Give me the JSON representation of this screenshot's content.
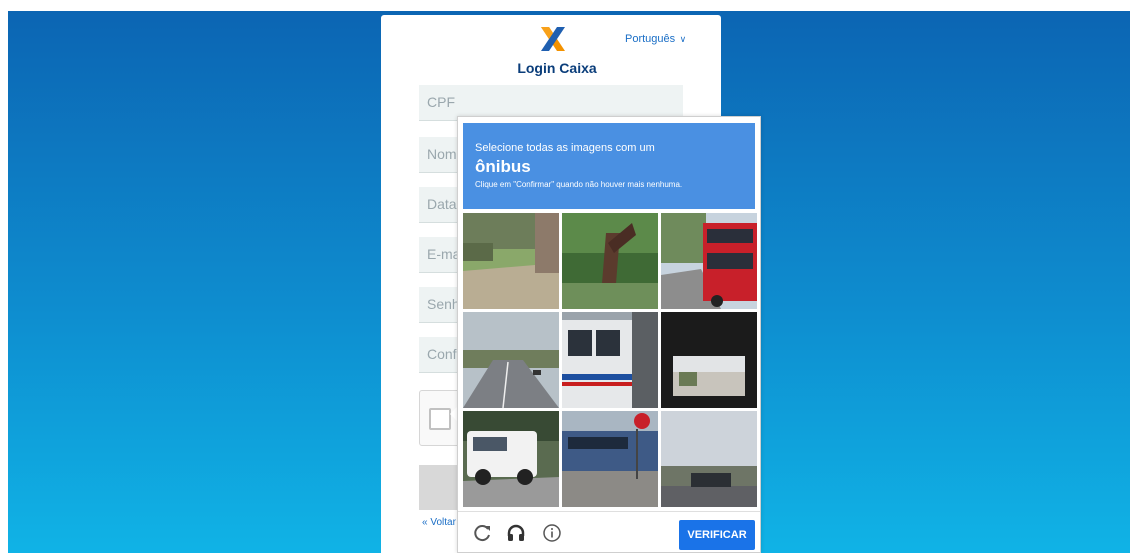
{
  "page": {
    "brand": "Login Caixa",
    "language": "Português",
    "back_link": "« Voltar"
  },
  "form": {
    "fields": [
      {
        "placeholder": "CPF"
      },
      {
        "placeholder": "Nom"
      },
      {
        "placeholder": "Data"
      },
      {
        "placeholder": "E-ma"
      },
      {
        "placeholder": "Senh"
      },
      {
        "placeholder": "Conf"
      }
    ]
  },
  "captcha": {
    "instruction": "Selecione todas as imagens com um",
    "target": "ônibus",
    "hint": "Clique em \"Confirmar\" quando não houver mais nenhuma.",
    "verify_label": "VERIFICAR",
    "tiles": [
      "street-with-grass",
      "tree-trunk",
      "red-double-decker-bus",
      "highway",
      "city-bus-closeup",
      "underpass-view",
      "white-suv",
      "bus-stop-street",
      "street-with-sky"
    ]
  },
  "colors": {
    "bg_top": "#0c65b3",
    "bg_bottom": "#10b3e6",
    "captcha_header": "#4a90e2",
    "verify_button": "#1a73e8",
    "logo_orange": "#f39200",
    "logo_blue": "#1f5fb0"
  },
  "icons": [
    "caixa-logo-icon",
    "chevron-down-icon",
    "reload-icon",
    "headphones-icon",
    "info-icon"
  ]
}
